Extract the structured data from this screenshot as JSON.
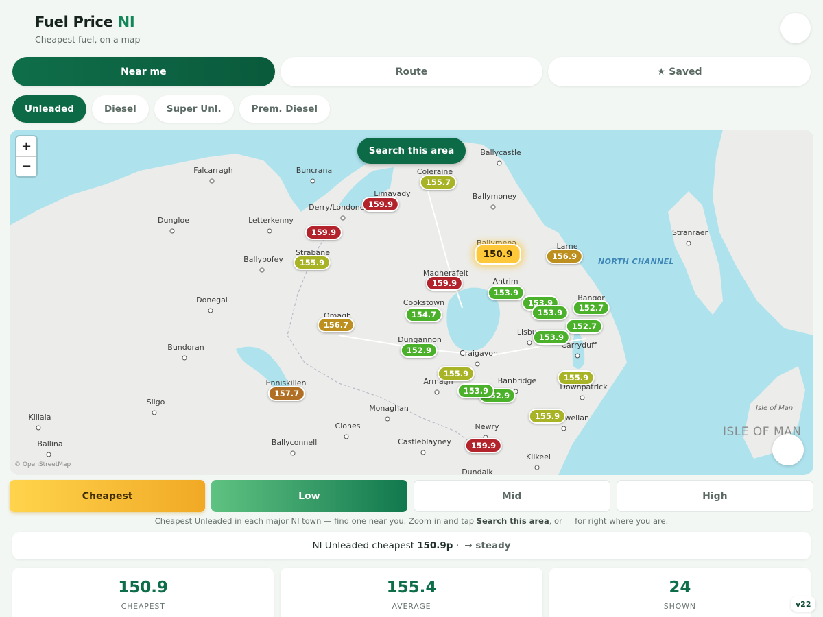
{
  "header": {
    "title_main": "Fuel Price ",
    "title_accent": "NI",
    "subtitle": "Cheapest fuel, on a map"
  },
  "mode_tabs": [
    {
      "label": "Near me",
      "active": true
    },
    {
      "label": "Route",
      "active": false
    },
    {
      "label": "★ Saved",
      "active": false
    }
  ],
  "fuel_chips": [
    {
      "label": "Unleaded",
      "active": true
    },
    {
      "label": "Diesel",
      "active": false
    },
    {
      "label": "Super Unl.",
      "active": false
    },
    {
      "label": "Prem. Diesel",
      "active": false
    }
  ],
  "map": {
    "zoom_in": "+",
    "zoom_out": "−",
    "search_button": "Search this area",
    "attribution": "© OpenStreetMap",
    "sea_label": "NORTH CHANNEL",
    "iom_label": "ISLE OF MAN",
    "iom_small": "Isle of Man",
    "towns": [
      "Ballycastle",
      "Falcarragh",
      "Buncrana",
      "Coleraine",
      "Limavady",
      "Ballymoney",
      "Derry/Londonderry",
      "Dungloe",
      "Letterkenny",
      "Strabane",
      "Ballymena",
      "Larne",
      "Ballybofey",
      "Magherafelt",
      "Antrim",
      "Bangor",
      "Donegal",
      "Cookstown",
      "Omagh",
      "Lisburn",
      "Carryduff",
      "Dungannon",
      "Craigavon",
      "Bundoran",
      "Enniskillen",
      "Armagh",
      "Banbridge",
      "Downpatrick",
      "Sligo",
      "Monaghan",
      "Castlewellan",
      "Killala",
      "Clones",
      "Newry",
      "Ballina",
      "Ballyconnell",
      "Castleblayney",
      "Kilkeel",
      "Dundalk",
      "Stranraer"
    ],
    "pins": [
      "155.7",
      "159.9",
      "159.9",
      "155.9",
      "150.9",
      "156.9",
      "159.9",
      "153.9",
      "153.9",
      "153.9",
      "152.7",
      "156.7",
      "154.7",
      "152.7",
      "153.9",
      "152.9",
      "155.9",
      "155.9",
      "152.9",
      "153.9",
      "157.7",
      "155.9",
      "159.9"
    ],
    "colors": {
      "red": "#b3232b",
      "yellow_green": "#a8b325",
      "green": "#4bb12b",
      "amber": "#bd8f1e",
      "brown": "#b06f22",
      "cheapest": "#ffc83a"
    }
  },
  "bands": [
    {
      "label": "Cheapest"
    },
    {
      "label": "Low"
    },
    {
      "label": "Mid"
    },
    {
      "label": "High"
    }
  ],
  "note": {
    "part1": "Cheapest Unleaded in each major NI town — find one near you. Zoom in and tap ",
    "bold": "Search this area",
    "part2": ", or     for right where you are."
  },
  "summary": {
    "prefix": "NI Unleaded cheapest",
    "value": "150.9p",
    "sep": " · ",
    "trend": "→ steady"
  },
  "stats": [
    {
      "value": "150.9",
      "label": "CHEAPEST"
    },
    {
      "value": "155.4",
      "label": "AVERAGE"
    },
    {
      "value": "24",
      "label": "SHOWN"
    }
  ],
  "version": "v22"
}
